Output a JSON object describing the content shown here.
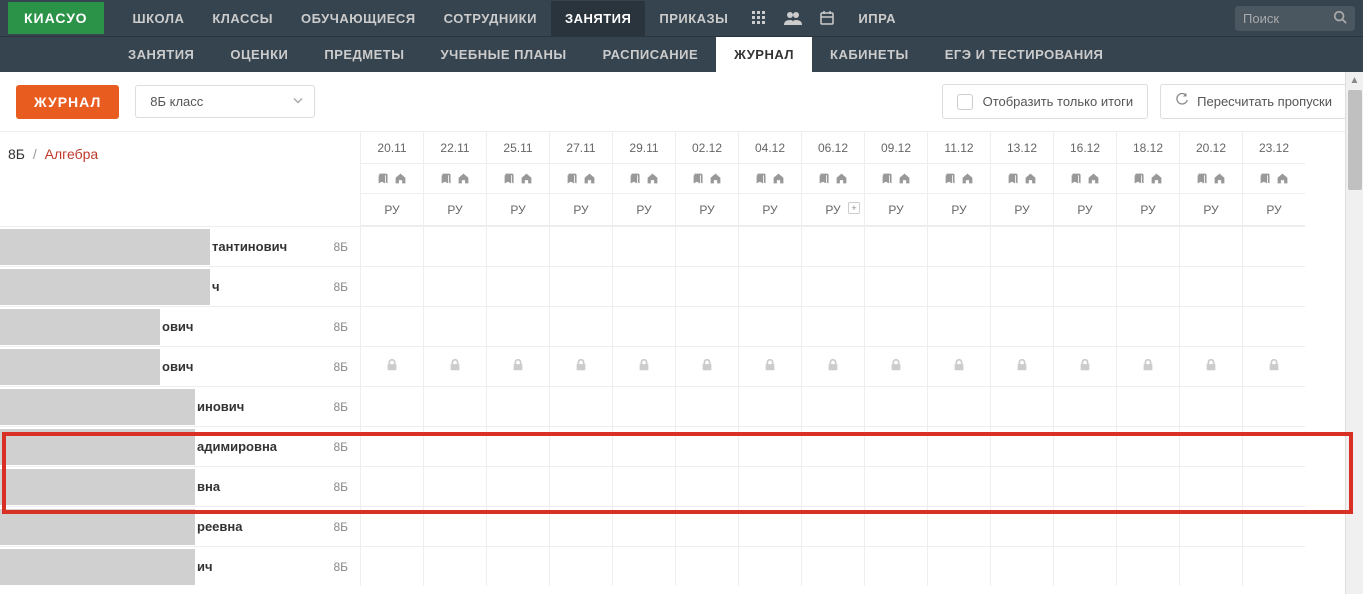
{
  "logo": "КИАСУО",
  "topnav": [
    {
      "label": "ШКОЛА"
    },
    {
      "label": "КЛАССЫ"
    },
    {
      "label": "ОБУЧАЮЩИЕСЯ"
    },
    {
      "label": "СОТРУДНИКИ"
    },
    {
      "label": "ЗАНЯТИЯ",
      "active": true
    },
    {
      "label": "ПРИКАЗЫ"
    }
  ],
  "topnav_extra": {
    "label": "ИПРА"
  },
  "search": {
    "placeholder": "Поиск"
  },
  "subnav": [
    {
      "label": "ЗАНЯТИЯ"
    },
    {
      "label": "ОЦЕНКИ"
    },
    {
      "label": "ПРЕДМЕТЫ"
    },
    {
      "label": "УЧЕБНЫЕ ПЛАНЫ"
    },
    {
      "label": "РАСПИСАНИЕ"
    },
    {
      "label": "ЖУРНАЛ",
      "active": true
    },
    {
      "label": "КАБИНЕТЫ"
    },
    {
      "label": "ЕГЭ И ТЕСТИРОВАНИЯ"
    }
  ],
  "toolbar": {
    "journal_btn": "ЖУРНАЛ",
    "class_select": "8Б класс",
    "only_results": "Отобразить только итоги",
    "recalc": "Пересчитать пропуски"
  },
  "breadcrumb": {
    "class": "8Б",
    "subject": "Алгебра"
  },
  "dates": [
    "20.11",
    "22.11",
    "25.11",
    "27.11",
    "29.11",
    "02.12",
    "04.12",
    "06.12",
    "09.12",
    "11.12",
    "13.12",
    "16.12",
    "18.12",
    "20.12",
    "23.12"
  ],
  "ru_label": "РУ",
  "plus_col_index": 7,
  "students": [
    {
      "name_suffix": "тантинович",
      "class": "8Б",
      "redact_w": 210,
      "locked": false
    },
    {
      "name_suffix": "ч",
      "class": "8Б",
      "redact_w": 210,
      "locked": false
    },
    {
      "name_suffix": "ович",
      "class": "8Б",
      "redact_w": 160,
      "locked": false
    },
    {
      "name_suffix": "ович",
      "class": "8Б",
      "redact_w": 160,
      "locked": true
    },
    {
      "name_suffix": "инович",
      "class": "8Б",
      "redact_w": 195,
      "locked": false
    },
    {
      "name_suffix": "адимировна",
      "class": "8Б",
      "redact_w": 195,
      "locked": false
    },
    {
      "name_suffix": "вна",
      "class": "8Б",
      "redact_w": 195,
      "locked": false
    },
    {
      "name_suffix": "реевна",
      "class": "8Б",
      "redact_w": 195,
      "locked": false
    },
    {
      "name_suffix": "ич",
      "class": "8Б",
      "redact_w": 195,
      "locked": false
    }
  ]
}
